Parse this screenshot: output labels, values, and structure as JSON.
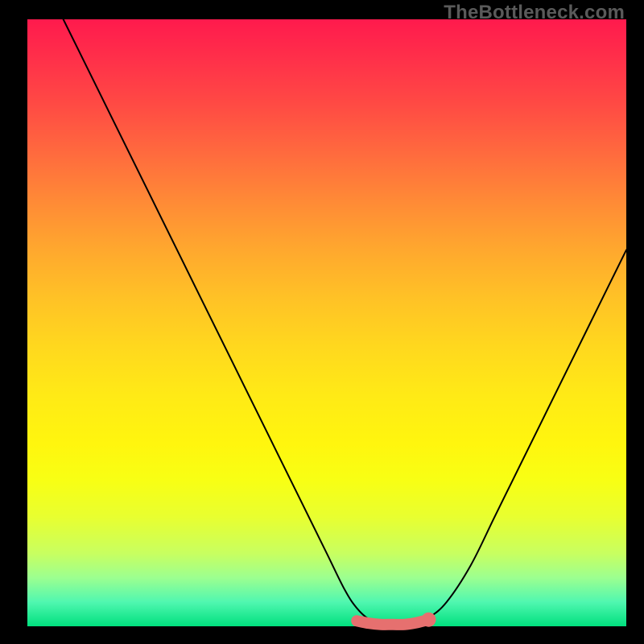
{
  "watermark": "TheBottleneck.com",
  "chart_data": {
    "type": "line",
    "title": "",
    "xlabel": "",
    "ylabel": "",
    "xlim": [
      0,
      100
    ],
    "ylim": [
      0,
      100
    ],
    "series": [
      {
        "name": "bottleneck-curve",
        "x": [
          6,
          10,
          14,
          18,
          22,
          26,
          30,
          34,
          38,
          42,
          46,
          50,
          53,
          55,
          57,
          59,
          61,
          63,
          65,
          67,
          70,
          74,
          78,
          82,
          86,
          90,
          94,
          98,
          100
        ],
        "values": [
          100,
          92,
          84,
          76,
          68,
          60,
          52,
          44,
          36,
          28,
          20,
          12,
          6,
          3,
          1.2,
          0.6,
          0.4,
          0.4,
          0.6,
          1.4,
          4,
          10,
          18,
          26,
          34,
          42,
          50,
          58,
          62
        ]
      },
      {
        "name": "flat-highlight",
        "x": [
          55,
          57,
          59,
          61,
          63,
          65,
          67
        ],
        "values": [
          0.9,
          0.5,
          0.3,
          0.3,
          0.3,
          0.6,
          1.1
        ]
      }
    ],
    "gradient_stops": [
      {
        "pos": 0,
        "color": "#ff1a4d"
      },
      {
        "pos": 50,
        "color": "#ffd400"
      },
      {
        "pos": 100,
        "color": "#00e07e"
      }
    ]
  }
}
